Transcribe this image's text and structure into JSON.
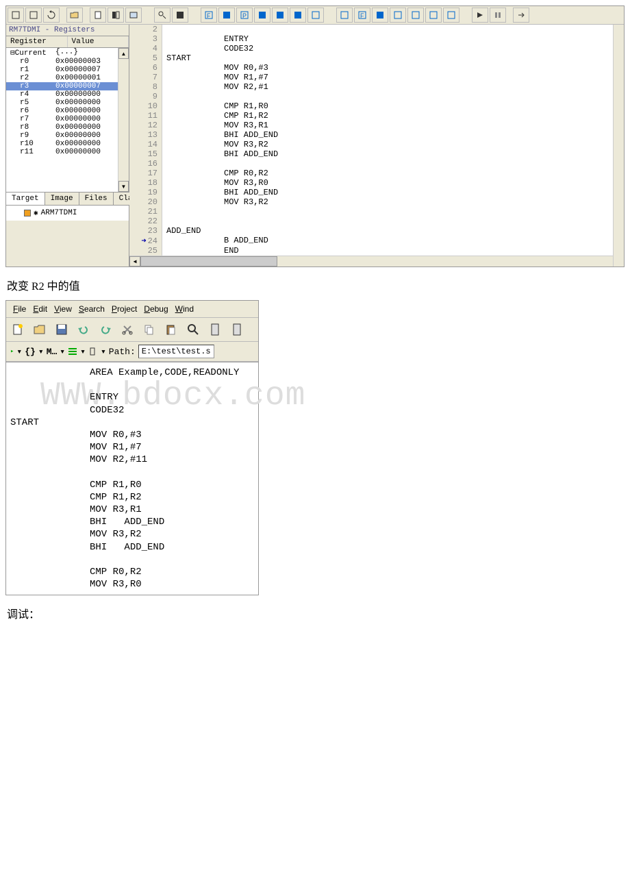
{
  "ide1": {
    "registers_title": "RM7TDMI - Registers",
    "header_register": "Register",
    "header_value": "Value",
    "rows": [
      {
        "name": "Current",
        "value": "{...}",
        "root": true
      },
      {
        "name": "r0",
        "value": "0x00000003"
      },
      {
        "name": "r1",
        "value": "0x00000007"
      },
      {
        "name": "r2",
        "value": "0x00000001"
      },
      {
        "name": "r3",
        "value": "0x00000007",
        "highlighted": true
      },
      {
        "name": "r4",
        "value": "0x00000000"
      },
      {
        "name": "r5",
        "value": "0x00000000"
      },
      {
        "name": "r6",
        "value": "0x00000000"
      },
      {
        "name": "r7",
        "value": "0x00000000"
      },
      {
        "name": "r8",
        "value": "0x00000000"
      },
      {
        "name": "r9",
        "value": "0x00000000"
      },
      {
        "name": "r10",
        "value": "0x00000000"
      },
      {
        "name": "r11",
        "value": "0x00000000"
      }
    ],
    "tabs": [
      "Target",
      "Image",
      "Files",
      "Class"
    ],
    "tree_item": "ARM7TDMI",
    "code": [
      {
        "n": "2",
        "label": "",
        "text": ""
      },
      {
        "n": "3",
        "label": "",
        "text": "          ENTRY"
      },
      {
        "n": "4",
        "label": "",
        "text": "          CODE32"
      },
      {
        "n": "5",
        "label": "START",
        "text": ""
      },
      {
        "n": "6",
        "label": "",
        "text": "          MOV R0,#3"
      },
      {
        "n": "7",
        "label": "",
        "text": "          MOV R1,#7"
      },
      {
        "n": "8",
        "label": "",
        "text": "          MOV R2,#1"
      },
      {
        "n": "9",
        "label": "",
        "text": ""
      },
      {
        "n": "10",
        "label": "",
        "text": "          CMP R1,R0"
      },
      {
        "n": "11",
        "label": "",
        "text": "          CMP R1,R2"
      },
      {
        "n": "12",
        "label": "",
        "text": "          MOV R3,R1"
      },
      {
        "n": "13",
        "label": "",
        "text": "          BHI   ADD_END"
      },
      {
        "n": "14",
        "label": "",
        "text": "          MOV R3,R2"
      },
      {
        "n": "15",
        "label": "",
        "text": "          BHI   ADD_END"
      },
      {
        "n": "16",
        "label": "",
        "text": ""
      },
      {
        "n": "17",
        "label": "",
        "text": "          CMP R0,R2"
      },
      {
        "n": "18",
        "label": "",
        "text": "          MOV R3,R0"
      },
      {
        "n": "19",
        "label": "",
        "text": "          BHI   ADD_END"
      },
      {
        "n": "20",
        "label": "",
        "text": "          MOV R3,R2"
      },
      {
        "n": "21",
        "label": "",
        "text": ""
      },
      {
        "n": "22",
        "label": "",
        "text": ""
      },
      {
        "n": "23",
        "label": "ADD_END",
        "text": ""
      },
      {
        "n": "24",
        "label": "",
        "text": "          B  ADD_END",
        "exec": true
      },
      {
        "n": "25",
        "label": "",
        "text": "            END"
      }
    ]
  },
  "caption1": "改变 R2 中的值",
  "ide2": {
    "menu": [
      {
        "u": "F",
        "rest": "ile"
      },
      {
        "u": "E",
        "rest": "dit"
      },
      {
        "u": "V",
        "rest": "iew"
      },
      {
        "u": "S",
        "rest": "earch"
      },
      {
        "u": "P",
        "rest": "roject"
      },
      {
        "u": "D",
        "rest": "ebug"
      },
      {
        "u": "W",
        "rest": "ind"
      }
    ],
    "path_label": "Path:",
    "path_value": "E:\\test\\test.s",
    "code": [
      {
        "label": "",
        "text": "     AREA Example,CODE,READONLY"
      },
      {
        "label": "",
        "text": ""
      },
      {
        "label": "",
        "text": "     ENTRY"
      },
      {
        "label": "",
        "text": "     CODE32"
      },
      {
        "label": "START",
        "text": ""
      },
      {
        "label": "",
        "text": "     MOV R0,#3"
      },
      {
        "label": "",
        "text": "     MOV R1,#7"
      },
      {
        "label": "",
        "text": "     MOV R2,#11"
      },
      {
        "label": "",
        "text": ""
      },
      {
        "label": "",
        "text": "     CMP R1,R0"
      },
      {
        "label": "",
        "text": "     CMP R1,R2"
      },
      {
        "label": "",
        "text": "     MOV R3,R1"
      },
      {
        "label": "",
        "text": "     BHI   ADD_END"
      },
      {
        "label": "",
        "text": "     MOV R3,R2"
      },
      {
        "label": "",
        "text": "     BHI   ADD_END"
      },
      {
        "label": "",
        "text": ""
      },
      {
        "label": "",
        "text": "     CMP R0,R2"
      },
      {
        "label": "",
        "text": "     MOV R3,R0"
      }
    ]
  },
  "watermark": "WWW.bdocx.com",
  "caption2": "调试："
}
